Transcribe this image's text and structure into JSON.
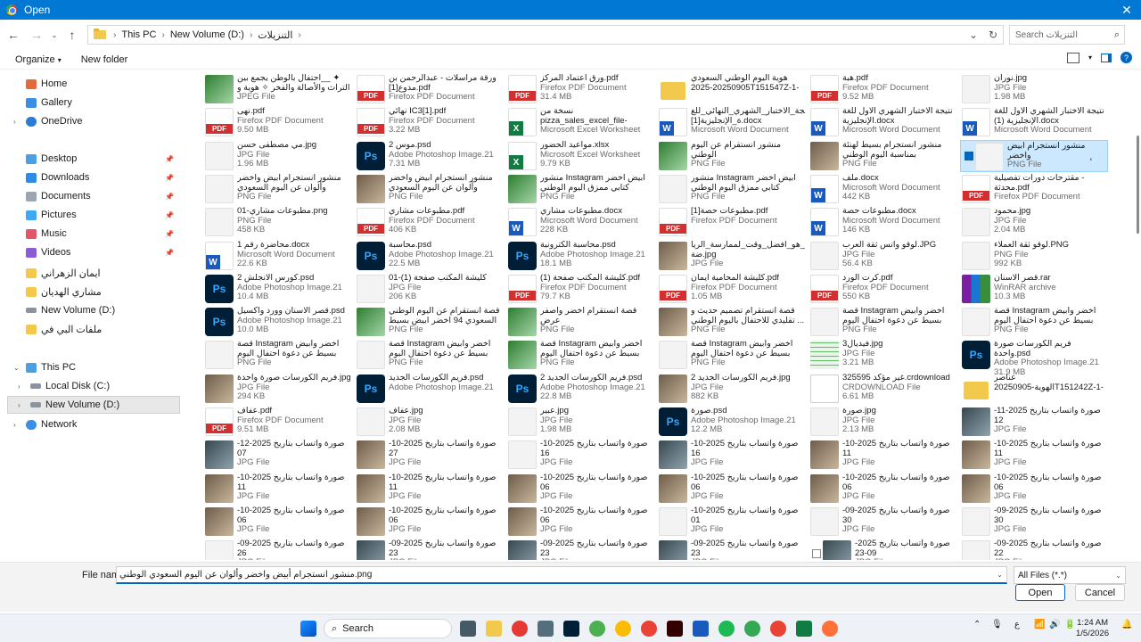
{
  "window": {
    "title": "Open",
    "close_glyph": "✕"
  },
  "address": {
    "crumbs": [
      "This PC",
      "New Volume (D:)",
      "التنزيلات"
    ],
    "search_placeholder": "Search التنزيلات"
  },
  "toolbar": {
    "organize": "Organize",
    "new_folder": "New folder"
  },
  "sidebar": {
    "items": [
      {
        "label": "Home",
        "icon": "home-icon"
      },
      {
        "label": "Gallery",
        "icon": "gallery-icon"
      },
      {
        "label": "OneDrive",
        "icon": "onedrive-icon"
      },
      {
        "label": "Desktop",
        "icon": "desktop-icon"
      },
      {
        "label": "Downloads",
        "icon": "downloads-icon"
      },
      {
        "label": "Documents",
        "icon": "documents-icon"
      },
      {
        "label": "Pictures",
        "icon": "pictures-icon"
      },
      {
        "label": "Music",
        "icon": "music-icon"
      },
      {
        "label": "Videos",
        "icon": "videos-icon"
      },
      {
        "label": "ايمان الزهراني",
        "icon": "folder-icon"
      },
      {
        "label": "مشاري الهديان",
        "icon": "folder-icon"
      },
      {
        "label": "New Volume (D:)",
        "icon": "drive-icon"
      },
      {
        "label": "ملفات البي في",
        "icon": "folder-icon"
      },
      {
        "label": "This PC",
        "icon": "pc-icon"
      },
      {
        "label": "Local Disk (C:)",
        "icon": "drive-icon"
      },
      {
        "label": "New Volume (D:)",
        "icon": "drive-icon"
      },
      {
        "label": "Network",
        "icon": "network-icon"
      }
    ]
  },
  "files": [
    [
      {
        "name": "احتفال بالوطن يجمع بين__ ✦\nالتراث والأصالة والفخر ✧ هوية و",
        "type": "JPEG File",
        "size": "",
        "kind": "img-green"
      },
      {
        "name": "ورقة مراسلات - عبدالرحمن بن\nمدوع[1].pdf",
        "type": "Firefox PDF Document",
        "size": "",
        "kind": "pdf"
      },
      {
        "name": "ورق اعتماد المركز.pdf",
        "type": "Firefox PDF Document",
        "size": "31.4 MB",
        "kind": "pdf"
      },
      {
        "name": "هوية اليوم الوطني السعودي\n2025-20250905T151547Z-1-00...",
        "type": "",
        "size": "",
        "kind": "folder"
      },
      {
        "name": "هبة.pdf",
        "type": "Firefox PDF Document",
        "size": "9.52 MB",
        "kind": "pdf"
      },
      {
        "name": "نوران.jpg",
        "type": "JPG File",
        "size": "1.98 MB",
        "kind": "img-light"
      }
    ],
    [
      {
        "name": "نهى.pdf",
        "type": "Firefox PDF Document",
        "size": "9.50 MB",
        "kind": "pdf"
      },
      {
        "name": "نهائي IC3[1].pdf",
        "type": "Firefox PDF Document",
        "size": "3.22 MB",
        "kind": "pdf"
      },
      {
        "name": "نسخة من\npizza_sales_excel_file-abozied ...",
        "type": "Microsoft Excel Worksheet",
        "size": "",
        "kind": "excel"
      },
      {
        "name": "نتيجة_الاختبار_الشهري_النهائي_للغ\nة_الإنجليزية[1].docx",
        "type": "Microsoft Word Document",
        "size": "",
        "kind": "word"
      },
      {
        "name": "نتيجة الاختبار الشهري الأول للغة\nالإنجليزية.docx",
        "type": "Microsoft Word Document",
        "size": "",
        "kind": "word"
      },
      {
        "name": "نتيجة الاختبار الشهري الأول للغة\nالإنجليزية (1).docx",
        "type": "Microsoft Word Document",
        "size": "",
        "kind": "word"
      }
    ],
    [
      {
        "name": "مي مصطفى حسن.jpg",
        "type": "JPG File",
        "size": "1.96 MB",
        "kind": "img-light"
      },
      {
        "name": "موس 2.psd",
        "type": "Adobe Photoshop Image.21",
        "size": "7.31 MB",
        "kind": "psd"
      },
      {
        "name": "مواعيد الحضور.xlsx",
        "type": "Microsoft Excel Worksheet",
        "size": "9.79 KB",
        "kind": "excel"
      },
      {
        "name": "منشور انستقرام عن اليوم الوطني\nالسعودي.png",
        "type": "PNG File",
        "size": "",
        "kind": "img-green"
      },
      {
        "name": "منشور انستجرام بسيط لهنئة\nبمناسبة اليوم الوطني السعودي...",
        "type": "PNG File",
        "size": "",
        "kind": "img-photo"
      },
      {
        "name": "منشور انستجرام أبيض واخضر\nوألوان عن اليوم السعودي الوط...",
        "type": "PNG File",
        "size": "",
        "kind": "img-light",
        "selected": true
      }
    ],
    [
      {
        "name": "منشور انستجرام أبيض واخضر\nوألوان عن اليوم السعودي الوط...",
        "type": "PNG File",
        "size": "",
        "kind": "img-light"
      },
      {
        "name": "منشور انستجرام أبيض واخضر\nوألوان عن اليوم السعودي الوط...",
        "type": "PNG File",
        "size": "",
        "kind": "img-photo"
      },
      {
        "name": "منشور Instagram ابيض اخضر\nكتابي ممزق اليوم الوطني السع...",
        "type": "PNG File",
        "size": "",
        "kind": "img-green"
      },
      {
        "name": "منشور Instagram ابيض اخضر\nكتابي ممزق اليوم الوطني السع...",
        "type": "PNG File",
        "size": "",
        "kind": "img-light"
      },
      {
        "name": "ملف.docx",
        "type": "Microsoft Word Document",
        "size": "442 KB",
        "kind": "word"
      },
      {
        "name": "مقترحات دورات تفصيلية -\nمحدثة.pdf",
        "type": "Firefox PDF Document",
        "size": "",
        "kind": "pdf"
      }
    ],
    [
      {
        "name": "مطبوعات مشاري-01.png",
        "type": "PNG File",
        "size": "458 KB",
        "kind": "img-light"
      },
      {
        "name": "مطبوعات مشاري.pdf",
        "type": "Firefox PDF Document",
        "size": "406 KB",
        "kind": "pdf"
      },
      {
        "name": "مطبوعات مشاري.docx",
        "type": "Microsoft Word Document",
        "size": "228 KB",
        "kind": "word"
      },
      {
        "name": "مطبوعات حصة[1].pdf",
        "type": "Firefox PDF Document",
        "size": "",
        "kind": "pdf"
      },
      {
        "name": "مطبوعات حصة.docx",
        "type": "Microsoft Word Document",
        "size": "146 KB",
        "kind": "word"
      },
      {
        "name": "محمود.jpg",
        "type": "JPG File",
        "size": "2.04 MB",
        "kind": "img-light"
      }
    ],
    [
      {
        "name": "محاضرة رقم 1.docx",
        "type": "Microsoft Word Document",
        "size": "22.6 KB",
        "kind": "word"
      },
      {
        "name": "محاسبة.psd",
        "type": "Adobe Photoshop Image.21",
        "size": "22.5 MB",
        "kind": "psd"
      },
      {
        "name": "محاسبة الكترونية.psd",
        "type": "Adobe Photoshop Image.21",
        "size": "18.1 MB",
        "kind": "psd"
      },
      {
        "name": "ما_هو_أفضل_وقت_لممارسة_الريا\nضة.jpg",
        "type": "JPG File",
        "size": "",
        "kind": "img-photo"
      },
      {
        "name": "لوقو واتس ثقة العرب.JPG",
        "type": "JPG File",
        "size": "56.4 KB",
        "kind": "img-light"
      },
      {
        "name": "لوقو ثقة العملاء.PNG",
        "type": "PNG File",
        "size": "992 KB",
        "kind": "img-light"
      }
    ],
    [
      {
        "name": "كورس الانجلش 2.psd",
        "type": "Adobe Photoshop Image.21",
        "size": "10.4 MB",
        "kind": "psd"
      },
      {
        "name": "كليشة المكتب صفحة (1)-01",
        "type": "JPG File",
        "size": "206 KB",
        "kind": "img-light"
      },
      {
        "name": "كليشة المكتب صفحة (1).pdf",
        "type": "Firefox PDF Document",
        "size": "79.7 KB",
        "kind": "pdf"
      },
      {
        "name": "كليشة المحامية ايمان.pdf",
        "type": "Firefox PDF Document",
        "size": "1.05 MB",
        "kind": "pdf"
      },
      {
        "name": "كرت الورد.pdf",
        "type": "Firefox PDF Document",
        "size": "550 KB",
        "kind": "pdf"
      },
      {
        "name": "قصر الاسنان.rar",
        "type": "WinRAR archive",
        "size": "10.3 MB",
        "kind": "rar"
      }
    ],
    [
      {
        "name": "قصر الاسنان وورد واكسيل.psd",
        "type": "Adobe Photoshop Image.21",
        "size": "10.0 MB",
        "kind": "psd"
      },
      {
        "name": "قصة انستقرام عن اليوم الوطني\nالسعودي 94 اخضر ابيض بسيط",
        "type": "PNG File",
        "size": "",
        "kind": "img-green"
      },
      {
        "name": "قصة انستقرام أخضر وأصفر عرض\nاليوم الوطني السعودي بطابع م...",
        "type": "PNG File",
        "size": "",
        "kind": "img-green"
      },
      {
        "name": "قصة انستقرام تصميم حديث و\nتقليدي للاحتفال باليوم الوطني ...",
        "type": "PNG File",
        "size": "",
        "kind": "img-photo"
      },
      {
        "name": "قصة Instagram اخضر وابيض\nبسيط عن دعوة احتفال اليوم ال...",
        "type": "PNG File",
        "size": "",
        "kind": "img-light"
      },
      {
        "name": "قصة Instagram اخضر وابيض\nبسيط عن دعوة احتفال اليوم ال...",
        "type": "PNG File",
        "size": "",
        "kind": "img-light"
      }
    ],
    [
      {
        "name": "قصة Instagram اخضر وابيض\nبسيط عن دعوة احتفال اليوم ال...",
        "type": "PNG File",
        "size": "",
        "kind": "img-light"
      },
      {
        "name": "قصة Instagram اخضر وابيض\nبسيط عن دعوة احتفال اليوم ال...",
        "type": "PNG File",
        "size": "",
        "kind": "img-light"
      },
      {
        "name": "قصة Instagram اخضر وابيض\nبسيط عن دعوة احتفال اليوم ال...",
        "type": "PNG File",
        "size": "",
        "kind": "img-green"
      },
      {
        "name": "قصة Instagram اخضر وابيض\nبسيط عن دعوة احتفال اليوم ال...",
        "type": "PNG File",
        "size": "",
        "kind": "img-light"
      },
      {
        "name": "فيديال3.jpg",
        "type": "JPG File",
        "size": "3.21 MB",
        "kind": "img-sheet"
      },
      {
        "name": "فريم الكورسات صورة واحدة.psd",
        "type": "Adobe Photoshop Image.21",
        "size": "31.9 MB",
        "kind": "psd"
      }
    ],
    [
      {
        "name": "فريم الكورسات صورة واحدة.jpg",
        "type": "JPG File",
        "size": "294 KB",
        "kind": "img-photo"
      },
      {
        "name": "فريم الكورسات الجديد.psd",
        "type": "Adobe Photoshop Image.21",
        "size": "",
        "kind": "psd"
      },
      {
        "name": "فريم الكورسات الجديد 2.psd",
        "type": "Adobe Photoshop Image.21",
        "size": "22.8 MB",
        "kind": "psd"
      },
      {
        "name": "فريم الكورسات الجديد 2.jpg",
        "type": "JPG File",
        "size": "882 KB",
        "kind": "img-photo"
      },
      {
        "name": "325595 غير مؤكد.crdownload",
        "type": "CRDOWNLOAD File",
        "size": "6.61 MB",
        "kind": "generic"
      },
      {
        "name": "عناصر\nالهوية-20250905T151242Z-1-0...",
        "type": "",
        "size": "",
        "kind": "folder"
      }
    ],
    [
      {
        "name": "عفاف.pdf",
        "type": "Firefox PDF Document",
        "size": "9.51 MB",
        "kind": "pdf"
      },
      {
        "name": "عفاف.jpg",
        "type": "JPG File",
        "size": "2.08 MB",
        "kind": "img-light"
      },
      {
        "name": "عبير.jpg",
        "type": "JPG File",
        "size": "1.98 MB",
        "kind": "img-light"
      },
      {
        "name": "صورة.psd",
        "type": "Adobe Photoshop Image.21",
        "size": "12.2 MB",
        "kind": "psd"
      },
      {
        "name": "صورة.jpg",
        "type": "JPG File",
        "size": "2.13 MB",
        "kind": "img-light"
      },
      {
        "name": "صورة واتساب بتاريخ 2025-11-12\nفي 14.34.34_371a4044b.jpg",
        "type": "JPG File",
        "size": "",
        "kind": "img-dark"
      }
    ],
    [
      {
        "name": "صورة واتساب بتاريخ 2025-12-07\nفي 10.37.15_802a88f.jpg",
        "type": "JPG File",
        "size": "",
        "kind": "img-dark"
      },
      {
        "name": "صورة واتساب بتاريخ 2025-10-27\nفي 16.34.52_b06789d3.jpg",
        "type": "JPG File",
        "size": "",
        "kind": "img-photo"
      },
      {
        "name": "صورة واتساب بتاريخ 2025-10-16\nفي 6_23.21.19_e68c74.jpg",
        "type": "JPG File",
        "size": "",
        "kind": "img-light"
      },
      {
        "name": "صورة واتساب بتاريخ 2025-10-16\nفي 4_23.21.19_bb67b0a.jpg",
        "type": "JPG File",
        "size": "",
        "kind": "img-dark"
      },
      {
        "name": "صورة واتساب بتاريخ 2025-10-11\nفي 11.35.46_f91d2e04.jpg",
        "type": "JPG File",
        "size": "",
        "kind": "img-photo"
      },
      {
        "name": "صورة واتساب بتاريخ 2025-10-11\nفي 11.33.06_b634f90b.jpg",
        "type": "JPG File",
        "size": "",
        "kind": "img-photo"
      }
    ],
    [
      {
        "name": "صورة واتساب بتاريخ 2025-10-11\nفي 8_10.58.02_a29d161.jpg",
        "type": "JPG File",
        "size": "",
        "kind": "img-photo"
      },
      {
        "name": "صورة واتساب بتاريخ 2025-10-11\nفي 1_10.56.49_bbf3f6d.jpg",
        "type": "JPG File",
        "size": "",
        "kind": "img-photo"
      },
      {
        "name": "صورة واتساب بتاريخ 2025-10-06\nفي 78001605_17.41.09.jpg",
        "type": "JPG File",
        "size": "",
        "kind": "img-photo"
      },
      {
        "name": "صورة واتساب بتاريخ 2025-10-06\nفي 8_17.41.06_b0d54d0.jpg",
        "type": "JPG File",
        "size": "",
        "kind": "img-photo"
      },
      {
        "name": "صورة واتساب بتاريخ 2025-10-06\nفي 585_14.27.00_e5729.jpg",
        "type": "JPG File",
        "size": "",
        "kind": "img-photo"
      },
      {
        "name": "صورة واتساب بتاريخ 2025-10-06\nفي 6_14.27.00_b0d61b3.jpg",
        "type": "JPG File",
        "size": "",
        "kind": "img-photo"
      }
    ],
    [
      {
        "name": "صورة واتساب بتاريخ 2025-10-06\nفي 14.25.05_f75b9115.jpg",
        "type": "JPG File",
        "size": "",
        "kind": "img-photo"
      },
      {
        "name": "صورة واتساب بتاريخ 2025-10-06\nفي 839_14.25.05_cc5e8.jpg",
        "type": "JPG File",
        "size": "",
        "kind": "img-photo"
      },
      {
        "name": "صورة واتساب بتاريخ 2025-10-06\nفي 14.25.02_b0f2824d.jpg",
        "type": "JPG File",
        "size": "",
        "kind": "img-photo"
      },
      {
        "name": "صورة واتساب بتاريخ 2025-10-01\nفي 15.00.30_c128ebfd.jpg",
        "type": "JPG File",
        "size": "",
        "kind": "img-light"
      },
      {
        "name": "صورة واتساب بتاريخ 2025-09-30\nفي 7_14.59.26_ace7ca1.jpg",
        "type": "JPG File",
        "size": "",
        "kind": "img-light"
      },
      {
        "name": "صورة واتساب بتاريخ 2025-09-30\nفي 41_12.19.31_afb39e2.jpg",
        "type": "JPG File",
        "size": "",
        "kind": "img-light"
      }
    ],
    [
      {
        "name": "صورة واتساب بتاريخ 2025-09-26\nفي 32_14.14.37_cf8d5.jpg",
        "type": "JPG File",
        "size": "",
        "kind": "img-light"
      },
      {
        "name": "صورة واتساب بتاريخ 2025-09-23\nفي 00.03.03_fd9b3f12.jpg",
        "type": "JPG File",
        "size": "",
        "kind": "img-dark"
      },
      {
        "name": "صورة واتساب بتاريخ 2025-09-23\nفي 00.03.03_c596ff00.jpg",
        "type": "JPG File",
        "size": "",
        "kind": "img-dark"
      },
      {
        "name": "صورة واتساب بتاريخ 2025-09-23\nفي 31_00.03.03_497f9c.jpg",
        "type": "JPG File",
        "size": "",
        "kind": "img-dark"
      },
      {
        "name": "صورة واتساب بتاريخ 2025-09-23\nفي 00.03.02_cf4eac5.jpg",
        "type": "JPG File",
        "size": "",
        "kind": "img-dark",
        "checkbox": "empty"
      },
      {
        "name": "صورة واتساب بتاريخ 2025-09-22\nفي 12.19.55_aef60ae1.jpg",
        "type": "JPG File",
        "size": "",
        "kind": "img-light"
      }
    ]
  ],
  "footer": {
    "file_name_label": "File name:",
    "file_name_value": "منشور انستجرام أبيض واخضر وألوان عن اليوم السعودي الوطني.png",
    "file_type": "All Files (*.*)",
    "open_label": "Open",
    "cancel_label": "Cancel"
  },
  "taskbar": {
    "search_label": "Search",
    "language": "ع",
    "time": "1:24 AM",
    "date": "1/5/2026"
  }
}
